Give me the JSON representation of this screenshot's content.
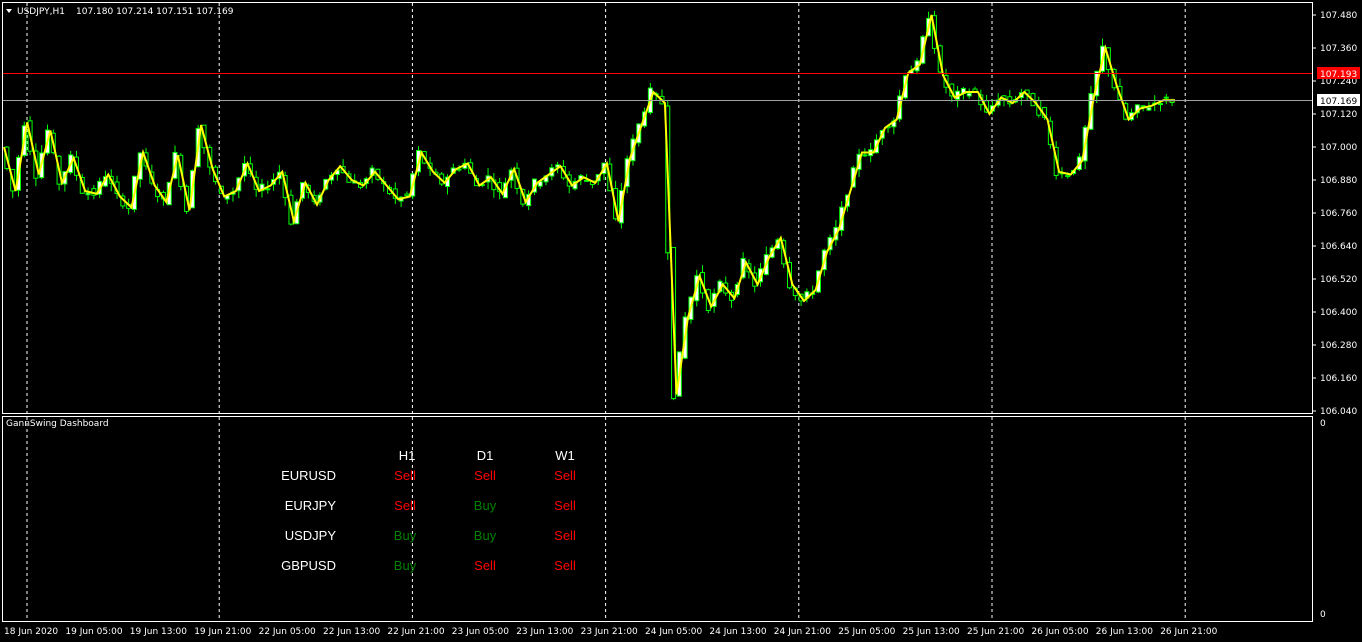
{
  "header": {
    "symbol": "USDJPY,H1",
    "ohlc": "107.180 107.214 107.151 107.169"
  },
  "price_axis": {
    "labels": [
      "107.480",
      "107.360",
      "107.240",
      "107.120",
      "107.000",
      "106.880",
      "106.760",
      "106.640",
      "106.520",
      "106.400",
      "106.280",
      "106.160",
      "106.040"
    ],
    "red_line_label": "107.193",
    "current_price_label": "107.169"
  },
  "indicator_axis": {
    "top_label": "0",
    "bottom_label": "0"
  },
  "time_axis": {
    "labels": [
      "18 Jun 2020",
      "19 Jun 05:00",
      "19 Jun 13:00",
      "19 Jun 21:00",
      "22 Jun 05:00",
      "22 Jun 13:00",
      "22 Jun 21:00",
      "23 Jun 05:00",
      "23 Jun 13:00",
      "23 Jun 21:00",
      "24 Jun 05:00",
      "24 Jun 13:00",
      "24 Jun 21:00",
      "25 Jun 05:00",
      "25 Jun 13:00",
      "25 Jun 21:00",
      "26 Jun 05:00",
      "26 Jun 13:00",
      "26 Jun 21:00"
    ]
  },
  "indicator": {
    "title": "GannSwing Dashboard",
    "columns": [
      "H1",
      "D1",
      "W1"
    ],
    "rows": [
      {
        "symbol": "EURUSD",
        "signals": [
          "Sell",
          "Sell",
          "Sell"
        ]
      },
      {
        "symbol": "EURJPY",
        "signals": [
          "Sell",
          "Buy",
          "Sell"
        ]
      },
      {
        "symbol": "USDJPY",
        "signals": [
          "Buy",
          "Buy",
          "Sell"
        ]
      },
      {
        "symbol": "GBPUSD",
        "signals": [
          "Buy",
          "Sell",
          "Sell"
        ]
      }
    ]
  },
  "colors": {
    "background": "#000000",
    "bull_candle": "#ffffff",
    "bear_candle": "#000000",
    "candle_wick": "#00ff00",
    "swing_line": "#ffff00",
    "red_line": "#ff0000",
    "current_line": "#c0c0c0",
    "buy": "#008000",
    "sell": "#ff0000",
    "grid": "#ffffff"
  },
  "chart_data": {
    "type": "candlestick",
    "symbol": "USDJPY",
    "timeframe": "H1",
    "ylim": [
      106.04,
      107.5
    ],
    "swing_points": [
      107.0,
      106.84,
      107.09,
      106.9,
      107.06,
      106.87,
      106.96,
      106.84,
      106.83,
      106.9,
      106.82,
      106.78,
      106.98,
      106.86,
      106.8,
      106.97,
      106.77,
      107.08,
      106.92,
      106.82,
      106.84,
      106.94,
      106.84,
      106.86,
      106.91,
      106.73,
      106.87,
      106.79,
      106.88,
      106.93,
      106.88,
      106.86,
      106.91,
      106.86,
      106.81,
      106.82,
      106.98,
      106.91,
      106.87,
      106.92,
      106.94,
      106.86,
      106.89,
      106.83,
      106.92,
      106.8,
      106.87,
      106.9,
      106.93,
      106.86,
      106.89,
      106.87,
      106.94,
      106.73,
      106.96,
      107.08,
      107.2,
      107.16,
      106.1,
      106.38,
      106.53,
      106.42,
      106.5,
      106.45,
      106.58,
      106.5,
      106.6,
      106.67,
      106.5,
      106.44,
      106.48,
      106.62,
      106.7,
      106.84,
      106.98,
      106.98,
      107.07,
      107.1,
      107.27,
      107.3,
      107.48,
      107.26,
      107.18,
      107.2,
      107.2,
      107.12,
      107.18,
      107.16,
      107.2,
      107.16,
      107.1,
      106.91,
      106.9,
      106.95,
      107.18,
      107.36,
      107.22,
      107.1,
      107.14,
      107.15,
      107.17,
      107.17
    ]
  }
}
